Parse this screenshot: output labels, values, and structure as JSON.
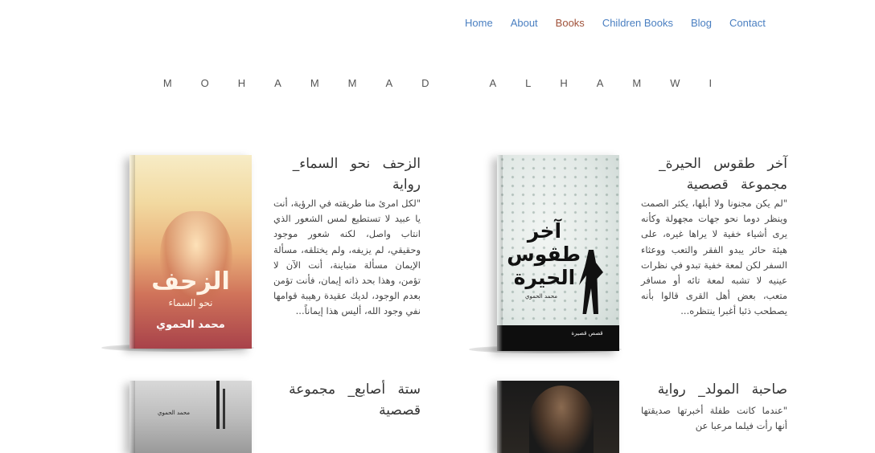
{
  "nav": {
    "items": [
      {
        "label": "Home"
      },
      {
        "label": "About"
      },
      {
        "label": "Books"
      },
      {
        "label": "Children Books"
      },
      {
        "label": "Blog"
      },
      {
        "label": "Contact"
      }
    ],
    "active_color": "#a0523a",
    "link_color": "#4a7fc1"
  },
  "site": {
    "title": "MOHAMMAD ALHAMWI"
  },
  "books": [
    {
      "title": "الزحف نحو السماء_ رواية",
      "description": "\"لكل امرئ منا طريقته في الرؤية، أنت يا عبيد لا تستطيع لمس الشعور الذي انتاب واصل، لكنه شعور موجود وحقيقي، لم يزيفه، ولم يختلقه، مسألة الإيمان مسألة متباينة، أنت الآن لا تؤمن، وهذا بحد ذاته إيمان، فأنت تؤمن بعدم الوجود، لديك عقيدة رهيبة قوامها نفي وجود الله، أليس هذا إيماناً...",
      "cover_title": "الزحف",
      "cover_subtitle": "نحو السماء",
      "cover_author": "محمد الحموي"
    },
    {
      "title": "آخر طقوس الحيرة_ مجموعة قصصية",
      "description": "\"لم يكن مجنونا ولا أبلها، يكثر الصمت وينظر دوما نحو جهات مجهولة وكأنه يرى أشياء خفية لا يراها غيره، على هيئة حائر يبدو الفقر والتعب ووعثاء السفر لكن لمعة خفية تبدو في نظرات عينيه لا تشبه لمعة تائه أو مسافر متعب، بعض أهل القرى قالوا بأنه يصطحب ذئبا أغبرا ينتظره...",
      "cover_title": "آخر طقوس الحيرة",
      "cover_author": "محمد الحموي",
      "cover_tag": "قصص قصيرة"
    },
    {
      "title": "ستة أصابع_ مجموعة قصصية",
      "cover_author": "محمد الحموي"
    },
    {
      "title": "صاحبة المولد_ رواية",
      "description": "\"عندما كانت طفلة أخبرتها صديقتها أنها رأت فيلما مرعبا عن"
    }
  ]
}
